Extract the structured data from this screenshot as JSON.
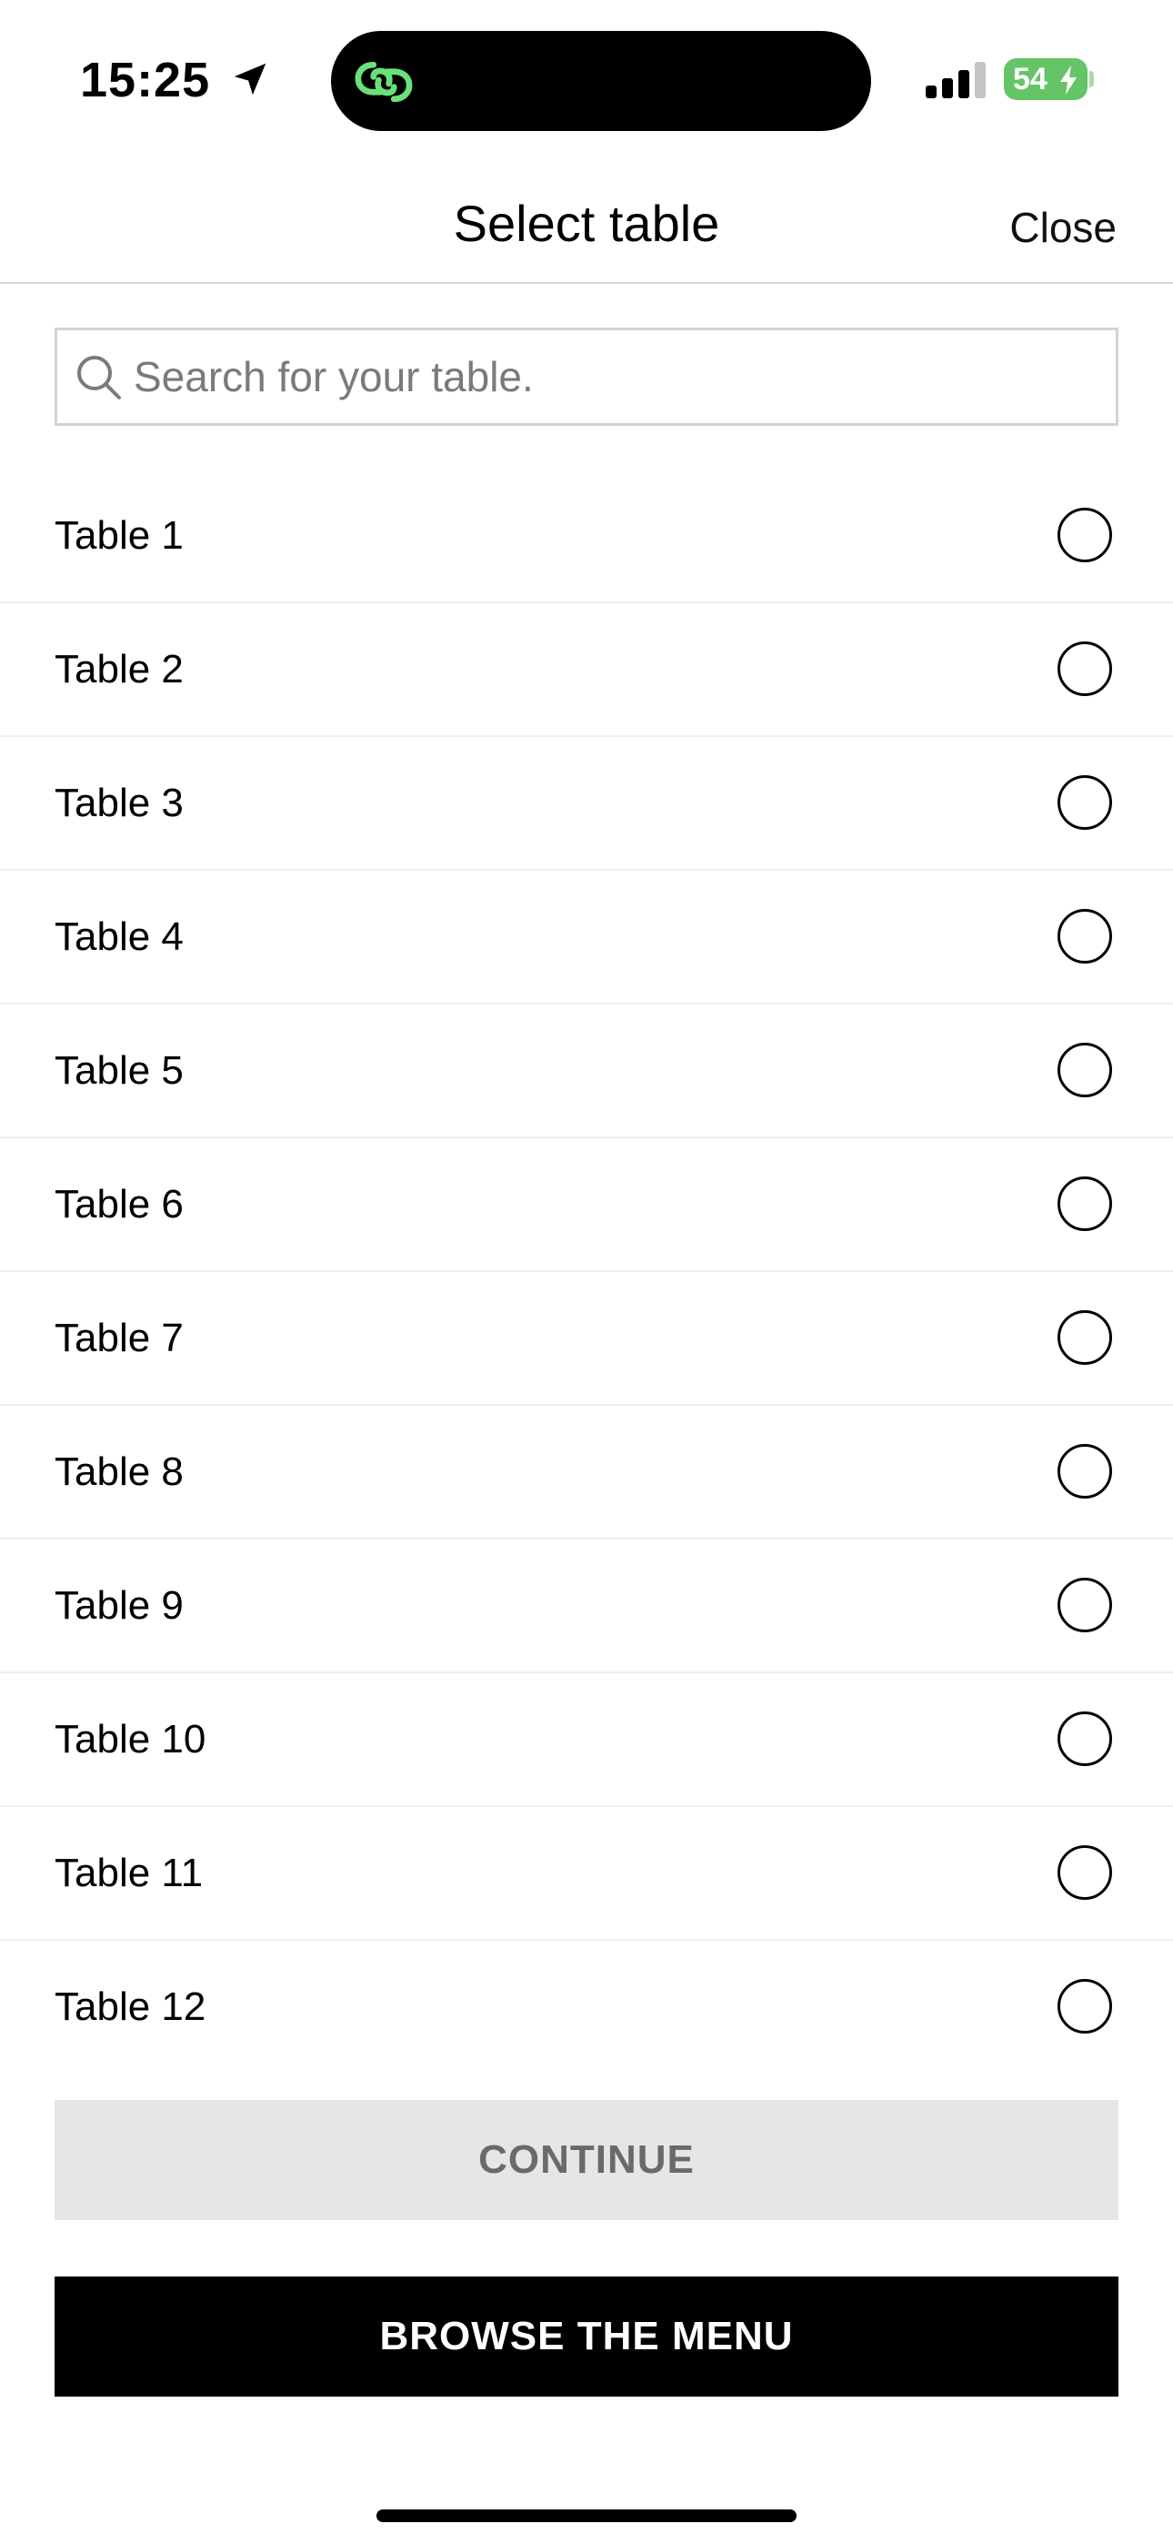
{
  "status_bar": {
    "time": "15:25",
    "battery_level": "54",
    "battery_color": "#65c466",
    "island_app_icon_color": "#6be07a",
    "icons": [
      "location-arrow-icon",
      "signal-bars-icon",
      "battery-charging-icon",
      "link-icon"
    ]
  },
  "header": {
    "title": "Select table",
    "close_label": "Close"
  },
  "search": {
    "placeholder": "Search for your table.",
    "value": ""
  },
  "tables": [
    {
      "label": "Table 1",
      "selected": false
    },
    {
      "label": "Table 2",
      "selected": false
    },
    {
      "label": "Table 3",
      "selected": false
    },
    {
      "label": "Table 4",
      "selected": false
    },
    {
      "label": "Table 5",
      "selected": false
    },
    {
      "label": "Table 6",
      "selected": false
    },
    {
      "label": "Table 7",
      "selected": false
    },
    {
      "label": "Table 8",
      "selected": false
    },
    {
      "label": "Table 9",
      "selected": false
    },
    {
      "label": "Table 10",
      "selected": false
    },
    {
      "label": "Table 11",
      "selected": false
    },
    {
      "label": "Table 12",
      "selected": false
    }
  ],
  "actions": {
    "continue_label": "CONTINUE",
    "continue_enabled": false,
    "browse_label": "BROWSE THE MENU"
  }
}
